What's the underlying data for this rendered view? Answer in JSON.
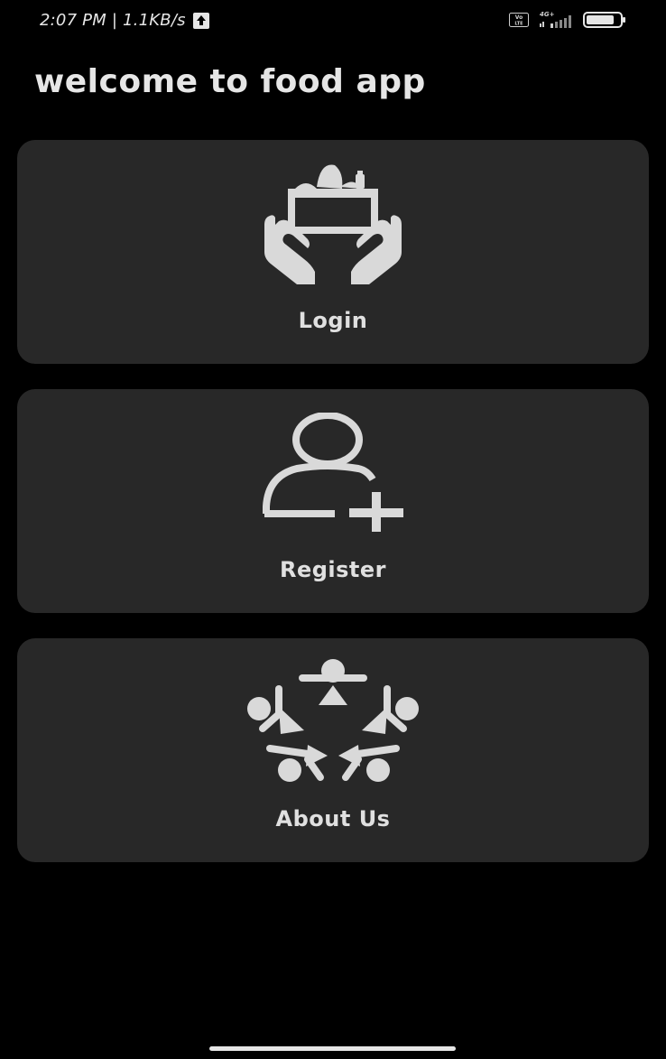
{
  "status_bar": {
    "time_speed": "2:07 PM | 1.1KB/s",
    "volte_label": "Vo\nLTE",
    "network_label": "4G+",
    "upload_icon": "upload-arrow-icon",
    "signal_icon": "signal-bars-icon",
    "battery_icon": "battery-icon"
  },
  "page": {
    "title": "welcome to food app"
  },
  "cards": [
    {
      "label": "Login",
      "icon": "hands-holding-groceries-icon"
    },
    {
      "label": "Register",
      "icon": "add-user-icon"
    },
    {
      "label": "About Us",
      "icon": "people-circle-icon"
    }
  ],
  "colors": {
    "background": "#000000",
    "card": "#282828",
    "foreground": "#d9d9d9"
  }
}
